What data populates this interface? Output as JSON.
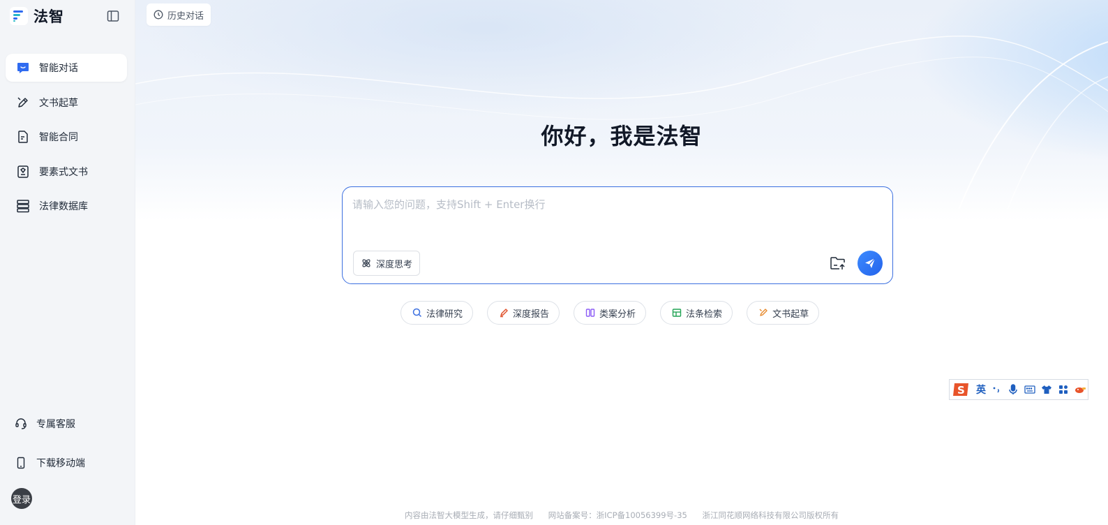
{
  "app": {
    "logo_text": "法智"
  },
  "header": {
    "history_label": "历史对话"
  },
  "sidebar": {
    "items": [
      {
        "label": "智能对话",
        "icon": "chat-icon",
        "active": true
      },
      {
        "label": "文书起草",
        "icon": "pen-icon"
      },
      {
        "label": "智能合同",
        "icon": "contract-icon"
      },
      {
        "label": "要素式文书",
        "icon": "element-doc-icon"
      },
      {
        "label": "法律数据库",
        "icon": "database-icon"
      }
    ],
    "service_label": "专属客服",
    "mobile_label": "下载移动端",
    "login_label": "登录"
  },
  "hero": {
    "title": "你好，我是法智"
  },
  "chat": {
    "placeholder": "请输入您的问题，支持Shift + Enter换行",
    "deep_think_label": "深度思考"
  },
  "chips": [
    {
      "label": "法律研究",
      "icon": "search-icon",
      "color": "#3b6fe0"
    },
    {
      "label": "深度报告",
      "icon": "report-icon",
      "color": "#e0532e"
    },
    {
      "label": "类案分析",
      "icon": "case-icon",
      "color": "#8b5cf6"
    },
    {
      "label": "法条检索",
      "icon": "table-icon",
      "color": "#22a455"
    },
    {
      "label": "文书起草",
      "icon": "pen-icon",
      "color": "#e6892c"
    }
  ],
  "footer": {
    "disclaimer": "内容由法智大模型生成，请仔细甄别",
    "icp": "网站备案号：浙ICP备10056399号-35",
    "copyright": "浙江同花顺网络科技有限公司版权所有"
  },
  "ime": {
    "mode": "英"
  },
  "colors": {
    "accent": "#2463eb",
    "border": "#3b6fe0"
  }
}
